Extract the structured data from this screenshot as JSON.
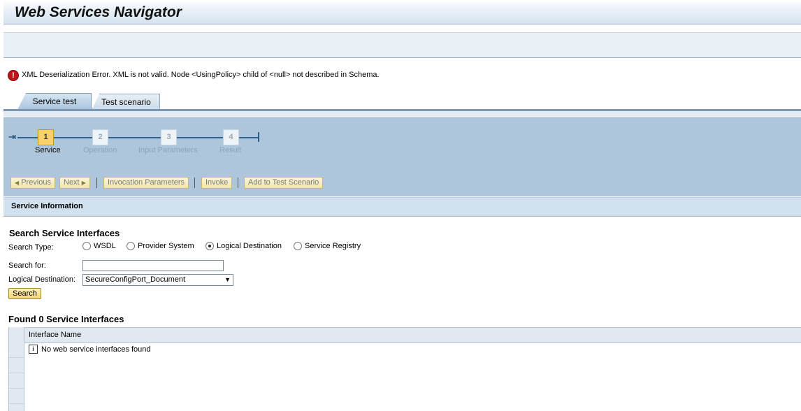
{
  "app": {
    "title": "Web Services Navigator"
  },
  "error": {
    "icon": "error-icon",
    "message": "XML Deserialization Error. XML is not valid. Node <UsingPolicy> child of <null> not described in Schema."
  },
  "tabs": [
    {
      "label": "Service test",
      "active": true
    },
    {
      "label": "Test scenario",
      "active": false
    }
  ],
  "roadmap": {
    "steps": [
      {
        "number": "1",
        "label": "Service",
        "active": true
      },
      {
        "number": "2",
        "label": "Operation",
        "active": false
      },
      {
        "number": "3",
        "label": "Input Parameters",
        "active": false
      },
      {
        "number": "4",
        "label": "Result",
        "active": false
      }
    ]
  },
  "toolbar": {
    "previous": "Previous",
    "next": "Next",
    "invocation_parameters": "Invocation Parameters",
    "invoke": "Invoke",
    "add_to_test_scenario": "Add to Test Scenario"
  },
  "section": {
    "title": "Service Information"
  },
  "search": {
    "heading": "Search Service Interfaces",
    "type_label": "Search Type:",
    "types": [
      {
        "label": "WSDL",
        "selected": false
      },
      {
        "label": "Provider System",
        "selected": false
      },
      {
        "label": "Logical Destination",
        "selected": true
      },
      {
        "label": "Service Registry",
        "selected": false
      }
    ],
    "search_for_label": "Search for:",
    "search_for_value": "",
    "logical_destination_label": "Logical Destination:",
    "logical_destination_value": "SecureConfigPort_Document",
    "button": "Search"
  },
  "results": {
    "heading": "Found 0 Service Interfaces",
    "column": "Interface Name",
    "empty_message": "No web service interfaces found"
  },
  "colors": {
    "roadmap_bg": "#aec6dc",
    "active_step": "#f7d26b",
    "error_red": "#c0141a"
  }
}
